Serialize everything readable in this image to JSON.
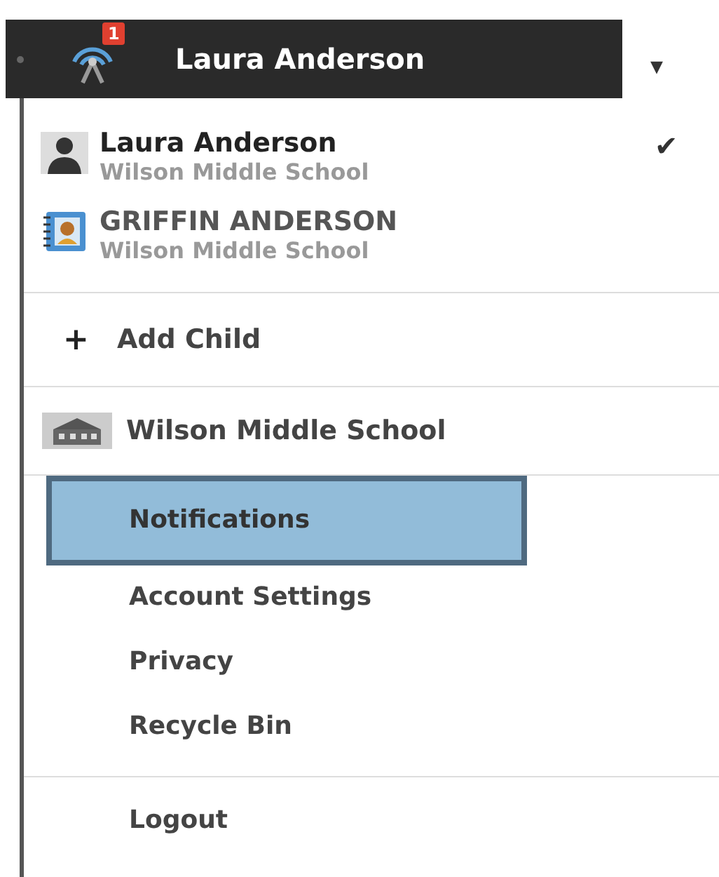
{
  "top_bar": {
    "badge": "1",
    "user_name": "Laura Anderson",
    "caret": "▾"
  },
  "accounts": [
    {
      "name": "Laura Anderson",
      "school": "Wilson Middle School",
      "kind": "parent",
      "selected": true
    },
    {
      "name": "GRIFFIN ANDERSON",
      "school": "Wilson Middle School",
      "kind": "child",
      "selected": false
    }
  ],
  "check_mark": "✔",
  "add_child": {
    "icon": "+",
    "label": "Add Child"
  },
  "school": {
    "label": "Wilson Middle School"
  },
  "links": [
    {
      "label": "Notifications",
      "selected": true
    },
    {
      "label": "Account Settings",
      "selected": false
    },
    {
      "label": "Privacy",
      "selected": false
    },
    {
      "label": "Recycle Bin",
      "selected": false
    }
  ],
  "logout": "Logout"
}
